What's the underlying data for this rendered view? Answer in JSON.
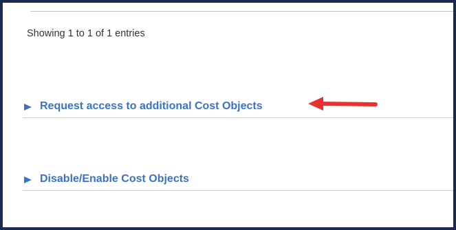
{
  "table": {
    "info": "Showing 1 to 1 of 1 entries"
  },
  "sections": [
    {
      "label": "Request access to additional Cost Objects",
      "toggle_icon": "triangle-right-icon",
      "expanded": false
    },
    {
      "label": "Disable/Enable Cost Objects",
      "toggle_icon": "triangle-right-icon",
      "expanded": false
    }
  ],
  "annotation": {
    "arrow_color": "#e8322f",
    "points_to": "Request access to additional Cost Objects"
  },
  "colors": {
    "frame": "#1a2a52",
    "link": "#3a72c8"
  }
}
